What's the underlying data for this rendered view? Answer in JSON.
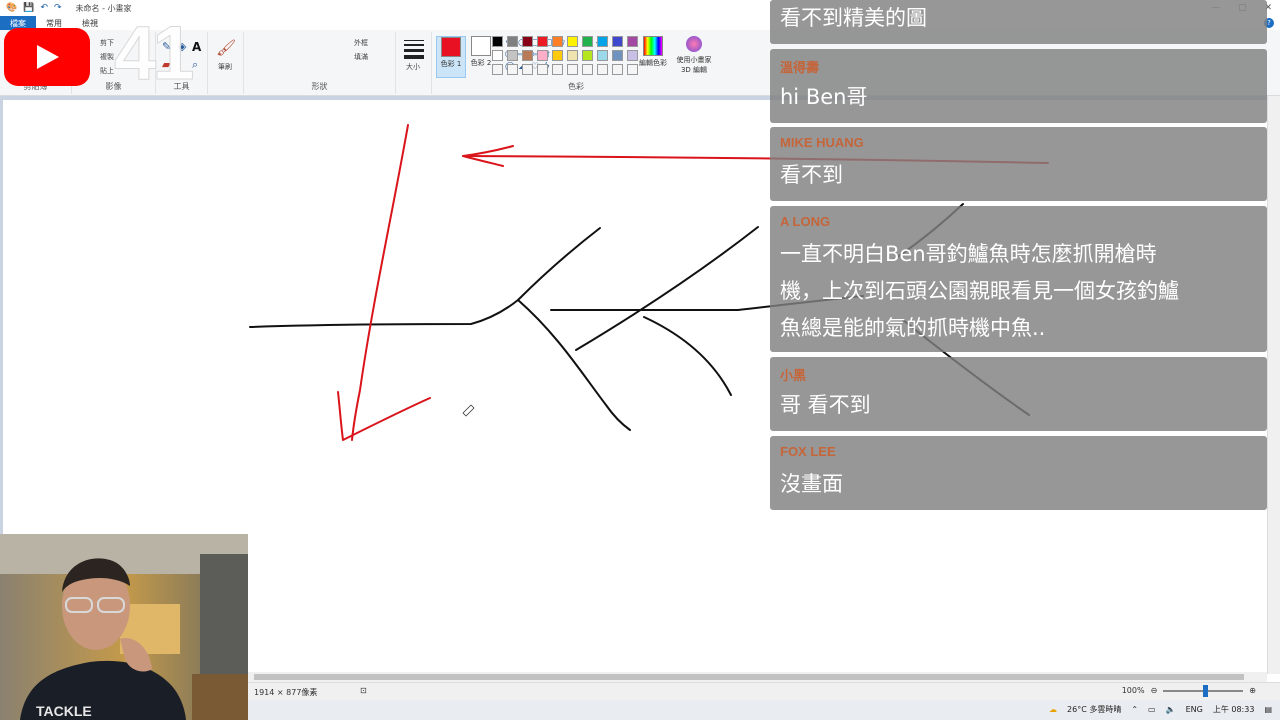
{
  "window": {
    "title": "未命名 - 小畫家",
    "controls": [
      "—",
      "▢",
      "✕"
    ]
  },
  "ribbon": {
    "tabs": [
      {
        "label": "檔案"
      },
      {
        "label": "常用"
      },
      {
        "label": "檢視"
      }
    ],
    "groups": {
      "clipboard": "剪貼簿",
      "image": "影像",
      "tools": "工具",
      "shapes": "形狀",
      "colors": "色彩"
    },
    "image_items": [
      "剪下",
      "複製",
      "貼上"
    ],
    "brush_label": "筆刷",
    "outline_label": "外框",
    "fill_label": "填滿",
    "size_label": "大小",
    "color1_label": "色彩 1",
    "color2_label": "色彩 2",
    "edit_colors_label": "編輯色彩",
    "paint3d_label": "使用小畫家 3D 編輯",
    "color1": "#e81123",
    "color2": "#ffffff",
    "palette": [
      "#000000",
      "#7f7f7f",
      "#880015",
      "#ed1c24",
      "#ff7f27",
      "#fff200",
      "#22b14c",
      "#00a2e8",
      "#3f48cc",
      "#a349a4",
      "#ffffff",
      "#c3c3c3",
      "#b97a57",
      "#ffaec9",
      "#ffc90e",
      "#efe4b0",
      "#b5e61d",
      "#99d9ea",
      "#7092be",
      "#c8bfe7",
      "#f5f5f5",
      "#f5f5f5",
      "#f5f5f5",
      "#f5f5f5",
      "#f5f5f5",
      "#f5f5f5",
      "#f5f5f5",
      "#f5f5f5",
      "#f5f5f5",
      "#f5f5f5"
    ]
  },
  "overlay": {
    "episode_number": "41"
  },
  "chat": [
    {
      "author": "",
      "text": "看不到精美的圖"
    },
    {
      "author": "溫得壽",
      "text": "hi Ben哥"
    },
    {
      "author": "MIKE HUANG",
      "text": "看不到"
    },
    {
      "author": "A LONG",
      "lines": [
        "一直不明白Ben哥釣鱸魚時怎麼抓開槍時",
        "機，上次到石頭公園親眼看見一個女孩釣鱸",
        "魚總是能帥氣的抓時機中魚.."
      ]
    },
    {
      "author": "小黑",
      "text": "哥 看不到"
    },
    {
      "author": "FOX LEE",
      "text": "沒畫面"
    }
  ],
  "status": {
    "dimensions": "1914 × 877像素",
    "zoom": "100%"
  },
  "taskbar": {
    "weather": "26°C 多雲時晴",
    "lang": "ENG",
    "time": "上午 08:33"
  },
  "colors": {
    "accent": "#1c6ec3",
    "chat_author": "#c5653a",
    "stroke_red": "#d9141b"
  }
}
